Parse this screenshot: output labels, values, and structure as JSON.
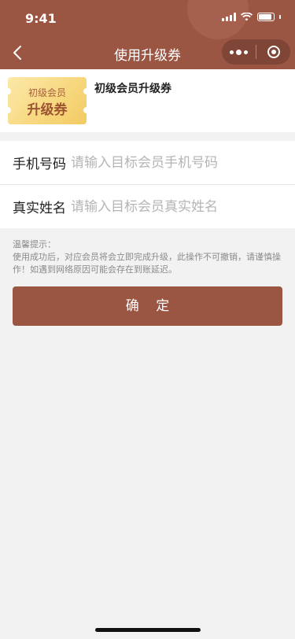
{
  "status_bar": {
    "time": "9:41"
  },
  "nav": {
    "title": "使用升级券"
  },
  "coupon": {
    "ticket_line1": "初级会员",
    "ticket_line2": "升级券",
    "title": "初级会员升级券",
    "colors": {
      "ticket_start": "#fbe9a8",
      "ticket_end": "#f3ca62"
    }
  },
  "form": {
    "phone_label": "手机号码",
    "phone_placeholder": "请输入目标会员手机号码",
    "name_label": "真实姓名",
    "name_placeholder": "请输入目标会员真实姓名"
  },
  "tips": {
    "title": "温馨提示：",
    "body": "使用成功后，对应会员将会立即完成升级，此操作不可撤销，请谨慎操作！如遇到网络原因可能会存在到账延迟。"
  },
  "actions": {
    "confirm_label": "确 定"
  },
  "colors": {
    "brand": "#9a5543",
    "background": "#f2f2f2"
  },
  "icons": [
    "back-icon",
    "more-dots-icon",
    "close-target-icon",
    "signal-icon",
    "wifi-icon",
    "battery-icon"
  ]
}
